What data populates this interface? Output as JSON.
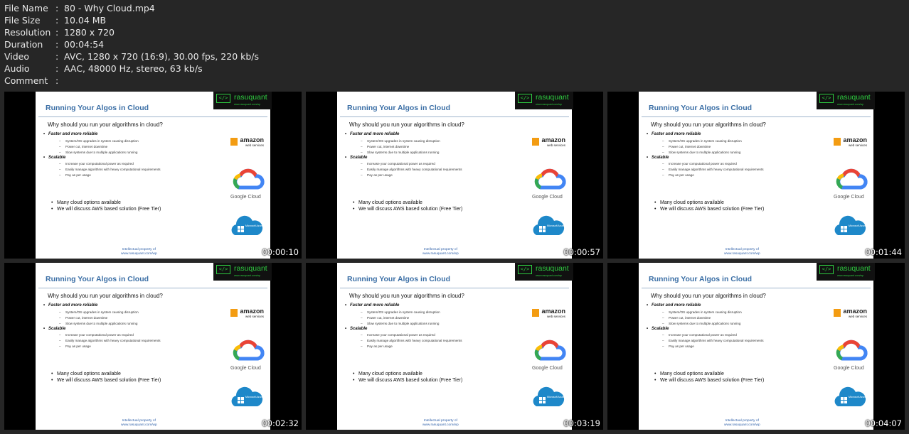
{
  "meta": [
    {
      "key": "File Name",
      "sep": ":",
      "value": "80 - Why Cloud.mp4"
    },
    {
      "key": "File Size",
      "sep": ":",
      "value": "10.04 MB"
    },
    {
      "key": "Resolution",
      "sep": ":",
      "value": "1280 x 720"
    },
    {
      "key": "Duration",
      "sep": ":",
      "value": "00:04:54"
    },
    {
      "key": "Video",
      "sep": ":",
      "value": "AVC, 1280 x 720 (16:9), 30.00 fps, 220 kb/s"
    },
    {
      "key": "Audio",
      "sep": ":",
      "value": "AAC, 48000 Hz, stereo, 63 kb/s"
    },
    {
      "key": "Comment",
      "sep": ":",
      "value": ""
    }
  ],
  "slide": {
    "title": "Running Your Algos in Cloud",
    "logo_name": "rasuquant",
    "logo_code": "</>",
    "logo_url": "www.rasuquant.com/wp",
    "question": "Why should you run your algorithms in cloud?",
    "section1": "Faster and more reliable",
    "s1_items": [
      "System/OS upgrades in system causing disruption",
      "Power cut, internet downtime",
      "Slow systems due to multiple applications running"
    ],
    "section2": "Scalable",
    "s2_items": [
      "Increase your computational power as required",
      "Easily manage algorithms with heavy computational requirements",
      "Pay as per usage"
    ],
    "bullets": [
      "Many cloud options available",
      "We will discuss AWS based solution (Free Tier)"
    ],
    "aws_word": "amazon",
    "aws_sub": "web services",
    "google_label": "Google Cloud",
    "azure_label": "Microsoft Azure",
    "footer_line1": "Intellectual property of",
    "footer_line2": "www.rasuquant.com/wp"
  },
  "thumbnails": [
    {
      "time": "00:00:10"
    },
    {
      "time": "00:00:57"
    },
    {
      "time": "00:01:44"
    },
    {
      "time": "00:02:32"
    },
    {
      "time": "00:03:19"
    },
    {
      "time": "00:04:07"
    }
  ],
  "colors": {
    "background": "#262626",
    "slide_title": "#3a6ea5",
    "logo_green": "#2ecc40",
    "footer_blue": "#2d5fa8",
    "aws_orange": "#f39c12",
    "azure_blue": "#1e88c9"
  }
}
